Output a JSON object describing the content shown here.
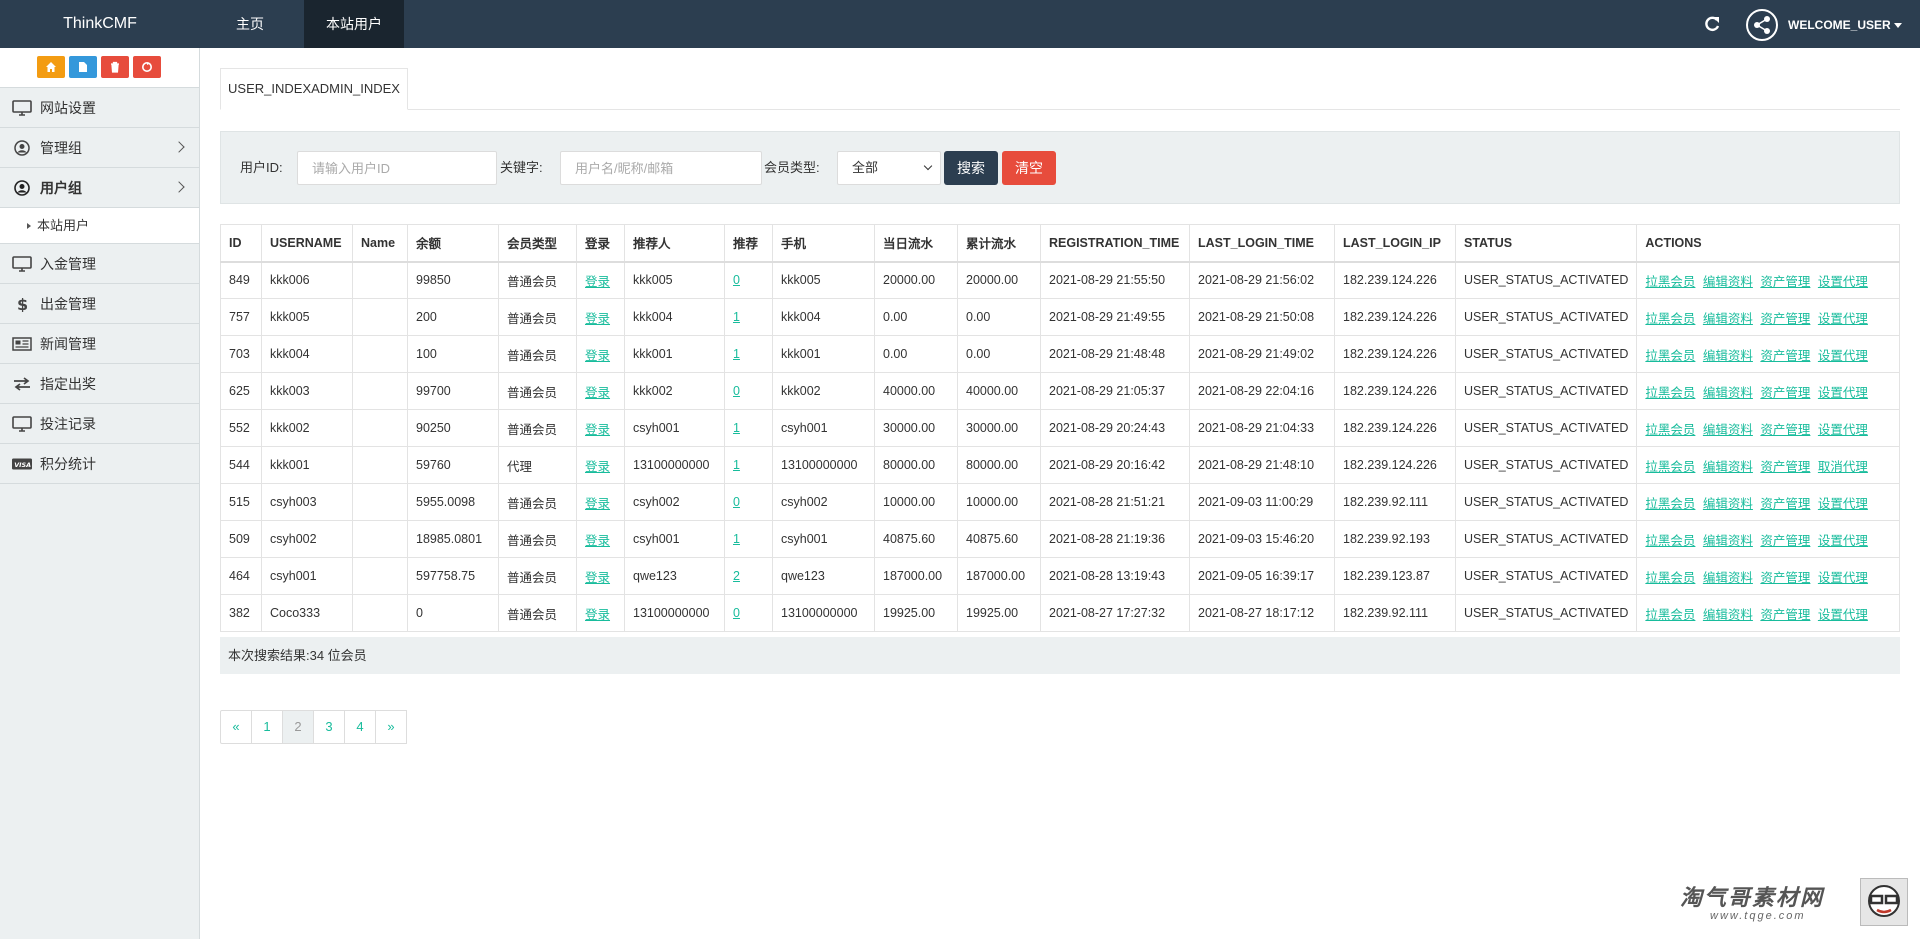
{
  "navbar": {
    "brand": "ThinkCMF",
    "tabs": [
      {
        "label": "主页"
      },
      {
        "label": "本站用户"
      }
    ],
    "user": "WELCOME_USER"
  },
  "sidebar": {
    "tool_buttons": [
      {
        "icon": "home-icon",
        "color": "#f39c12"
      },
      {
        "icon": "file-icon",
        "color": "#3498db"
      },
      {
        "icon": "trash-icon",
        "color": "#e74c3c"
      },
      {
        "icon": "recycle-icon",
        "color": "#e74c3c"
      }
    ],
    "items": [
      {
        "label": "网站设置",
        "icon": "monitor-icon"
      },
      {
        "label": "管理组",
        "icon": "user-circle-icon"
      },
      {
        "label": "用户组",
        "icon": "user-circle-icon"
      },
      {
        "label": "入金管理",
        "icon": "monitor-icon"
      },
      {
        "label": "出金管理",
        "icon": "dollar-icon"
      },
      {
        "label": "新闻管理",
        "icon": "newspaper-icon"
      },
      {
        "label": "指定出奖",
        "icon": "exchange-icon"
      },
      {
        "label": "投注记录",
        "icon": "monitor-icon"
      },
      {
        "label": "积分统计",
        "icon": "visa-icon"
      }
    ],
    "submenu": {
      "label": "本站用户"
    }
  },
  "main": {
    "tab_label": "USER_INDEXADMIN_INDEX",
    "search": {
      "user_id_label": "用户ID:",
      "user_id_placeholder": "请输入用户ID",
      "keyword_label": "关键字:",
      "keyword_placeholder": "用户名/昵称/邮箱",
      "member_type_label": "会员类型:",
      "member_type_value": "全部",
      "search_button": "搜索",
      "clear_button": "清空"
    },
    "table": {
      "columns": [
        "ID",
        "USERNAME",
        "Name",
        "余额",
        "会员类型",
        "登录",
        "推荐人",
        "推荐",
        "手机",
        "当日流水",
        "累计流水",
        "REGISTRATION_TIME",
        "LAST_LOGIN_TIME",
        "LAST_LOGIN_IP",
        "STATUS",
        "ACTIONS"
      ],
      "rows": [
        {
          "id": "849",
          "username": "kkk006",
          "name": "",
          "balance": "99850",
          "type": "普通会员",
          "login": "登录",
          "referrer": "kkk005",
          "ref_count": "0",
          "phone": "kkk005",
          "daily": "20000.00",
          "total": "20000.00",
          "reg": "2021-08-29 21:55:50",
          "last": "2021-08-29 21:56:02",
          "ip": "182.239.124.226",
          "status": "USER_STATUS_ACTIVATED",
          "a1": "拉黑会员",
          "a2": "编辑资料",
          "a3": "资产管理",
          "a4": "设置代理"
        },
        {
          "id": "757",
          "username": "kkk005",
          "name": "",
          "balance": "200",
          "type": "普通会员",
          "login": "登录",
          "referrer": "kkk004",
          "ref_count": "1",
          "phone": "kkk004",
          "daily": "0.00",
          "total": "0.00",
          "reg": "2021-08-29 21:49:55",
          "last": "2021-08-29 21:50:08",
          "ip": "182.239.124.226",
          "status": "USER_STATUS_ACTIVATED",
          "a1": "拉黑会员",
          "a2": "编辑资料",
          "a3": "资产管理",
          "a4": "设置代理"
        },
        {
          "id": "703",
          "username": "kkk004",
          "name": "",
          "balance": "100",
          "type": "普通会员",
          "login": "登录",
          "referrer": "kkk001",
          "ref_count": "1",
          "phone": "kkk001",
          "daily": "0.00",
          "total": "0.00",
          "reg": "2021-08-29 21:48:48",
          "last": "2021-08-29 21:49:02",
          "ip": "182.239.124.226",
          "status": "USER_STATUS_ACTIVATED",
          "a1": "拉黑会员",
          "a2": "编辑资料",
          "a3": "资产管理",
          "a4": "设置代理"
        },
        {
          "id": "625",
          "username": "kkk003",
          "name": "",
          "balance": "99700",
          "type": "普通会员",
          "login": "登录",
          "referrer": "kkk002",
          "ref_count": "0",
          "phone": "kkk002",
          "daily": "40000.00",
          "total": "40000.00",
          "reg": "2021-08-29 21:05:37",
          "last": "2021-08-29 22:04:16",
          "ip": "182.239.124.226",
          "status": "USER_STATUS_ACTIVATED",
          "a1": "拉黑会员",
          "a2": "编辑资料",
          "a3": "资产管理",
          "a4": "设置代理"
        },
        {
          "id": "552",
          "username": "kkk002",
          "name": "",
          "balance": "90250",
          "type": "普通会员",
          "login": "登录",
          "referrer": "csyh001",
          "ref_count": "1",
          "phone": "csyh001",
          "daily": "30000.00",
          "total": "30000.00",
          "reg": "2021-08-29 20:24:43",
          "last": "2021-08-29 21:04:33",
          "ip": "182.239.124.226",
          "status": "USER_STATUS_ACTIVATED",
          "a1": "拉黑会员",
          "a2": "编辑资料",
          "a3": "资产管理",
          "a4": "设置代理"
        },
        {
          "id": "544",
          "username": "kkk001",
          "name": "",
          "balance": "59760",
          "type": "代理",
          "login": "登录",
          "referrer": "13100000000",
          "ref_count": "1",
          "phone": "13100000000",
          "daily": "80000.00",
          "total": "80000.00",
          "reg": "2021-08-29 20:16:42",
          "last": "2021-08-29 21:48:10",
          "ip": "182.239.124.226",
          "status": "USER_STATUS_ACTIVATED",
          "a1": "拉黑会员",
          "a2": "编辑资料",
          "a3": "资产管理",
          "a4": "取消代理"
        },
        {
          "id": "515",
          "username": "csyh003",
          "name": "",
          "balance": "5955.0098",
          "type": "普通会员",
          "login": "登录",
          "referrer": "csyh002",
          "ref_count": "0",
          "phone": "csyh002",
          "daily": "10000.00",
          "total": "10000.00",
          "reg": "2021-08-28 21:51:21",
          "last": "2021-09-03 11:00:29",
          "ip": "182.239.92.111",
          "status": "USER_STATUS_ACTIVATED",
          "a1": "拉黑会员",
          "a2": "编辑资料",
          "a3": "资产管理",
          "a4": "设置代理"
        },
        {
          "id": "509",
          "username": "csyh002",
          "name": "",
          "balance": "18985.0801",
          "type": "普通会员",
          "login": "登录",
          "referrer": "csyh001",
          "ref_count": "1",
          "phone": "csyh001",
          "daily": "40875.60",
          "total": "40875.60",
          "reg": "2021-08-28 21:19:36",
          "last": "2021-09-03 15:46:20",
          "ip": "182.239.92.193",
          "status": "USER_STATUS_ACTIVATED",
          "a1": "拉黑会员",
          "a2": "编辑资料",
          "a3": "资产管理",
          "a4": "设置代理"
        },
        {
          "id": "464",
          "username": "csyh001",
          "name": "",
          "balance": "597758.75",
          "type": "普通会员",
          "login": "登录",
          "referrer": "qwe123",
          "ref_count": "2",
          "phone": "qwe123",
          "daily": "187000.00",
          "total": "187000.00",
          "reg": "2021-08-28 13:19:43",
          "last": "2021-09-05 16:39:17",
          "ip": "182.239.123.87",
          "status": "USER_STATUS_ACTIVATED",
          "a1": "拉黑会员",
          "a2": "编辑资料",
          "a3": "资产管理",
          "a4": "设置代理"
        },
        {
          "id": "382",
          "username": "Coco333",
          "name": "",
          "balance": "0",
          "type": "普通会员",
          "login": "登录",
          "referrer": "13100000000",
          "ref_count": "0",
          "phone": "13100000000",
          "daily": "19925.00",
          "total": "19925.00",
          "reg": "2021-08-27 17:27:32",
          "last": "2021-08-27 18:17:12",
          "ip": "182.239.92.111",
          "status": "USER_STATUS_ACTIVATED",
          "a1": "拉黑会员",
          "a2": "编辑资料",
          "a3": "资产管理",
          "a4": "设置代理"
        }
      ],
      "footer": "本次搜索结果:34 位会员"
    },
    "pagination": {
      "prev": "«",
      "pages": [
        "1",
        "2",
        "3",
        "4"
      ],
      "current": "2",
      "next": "»"
    }
  },
  "watermark": {
    "text": "淘气哥素材网",
    "url": "www.tqge.com"
  },
  "colors": {
    "navbar": "#2c3e50",
    "link": "#18bc9c",
    "danger": "#e74c3c",
    "warning": "#f39c12",
    "info": "#3498db"
  }
}
